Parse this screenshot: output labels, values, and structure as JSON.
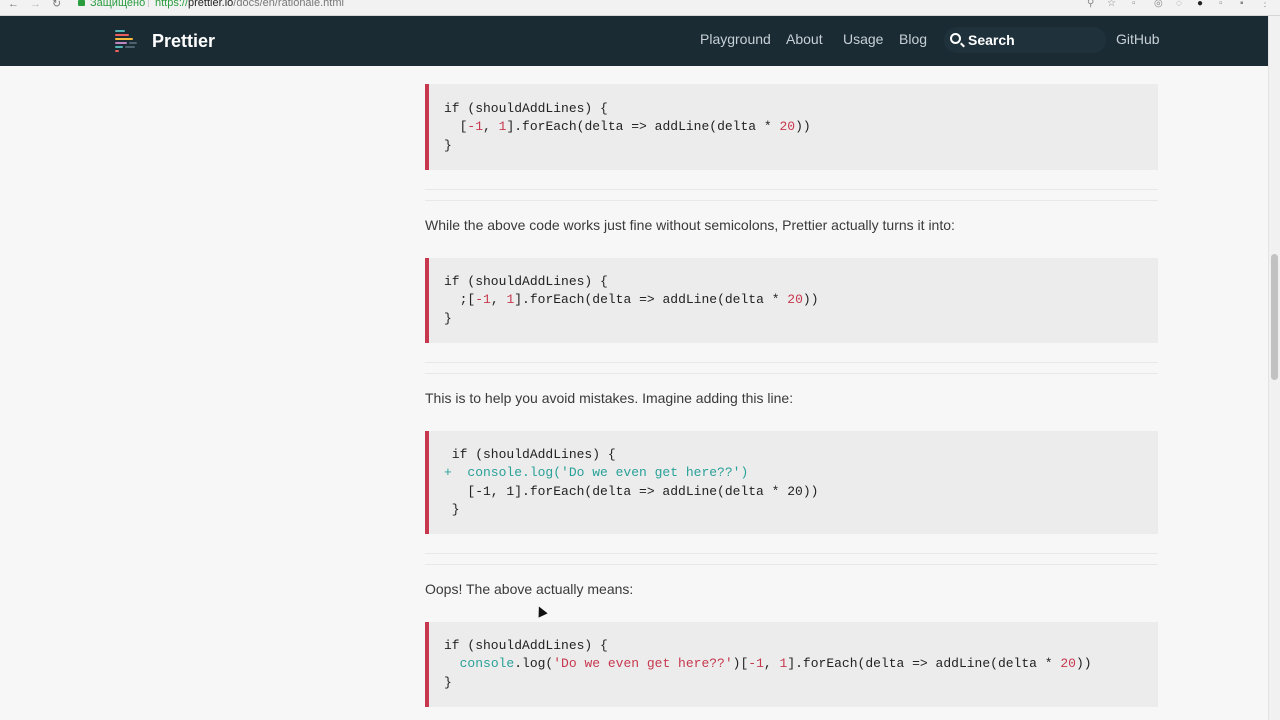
{
  "browser": {
    "secure_label": "Защищено",
    "url_proto": "https://",
    "url_host": "prettier.io",
    "url_path": "/docs/en/rationale.html"
  },
  "nav": {
    "brand": "Prettier",
    "links": [
      "Playground",
      "About",
      "Usage",
      "Blog"
    ],
    "search_placeholder": "Search",
    "github": "GitHub"
  },
  "content": {
    "para1": "While the above code works just fine without semicolons, Prettier actually turns it into:",
    "para2": "This is to help you avoid mistakes. Imagine adding this line:",
    "para3": "Oops! The above actually means:"
  },
  "code_blocks": [
    {
      "lines": [
        [
          {
            "t": "if (shouldAddLines) {"
          }
        ],
        [
          {
            "t": "  ["
          },
          {
            "t": "-1",
            "c": "num"
          },
          {
            "t": ", "
          },
          {
            "t": "1",
            "c": "num"
          },
          {
            "t": "].forEach(delta => addLine(delta * "
          },
          {
            "t": "20",
            "c": "num"
          },
          {
            "t": "))"
          }
        ],
        [
          {
            "t": "}"
          }
        ]
      ]
    },
    {
      "lines": [
        [
          {
            "t": "if (shouldAddLines) {"
          }
        ],
        [
          {
            "t": "  ;["
          },
          {
            "t": "-1",
            "c": "num"
          },
          {
            "t": ", "
          },
          {
            "t": "1",
            "c": "num"
          },
          {
            "t": "].forEach(delta => addLine(delta * "
          },
          {
            "t": "20",
            "c": "num"
          },
          {
            "t": "))"
          }
        ],
        [
          {
            "t": "}"
          }
        ]
      ]
    },
    {
      "lines": [
        [
          {
            "t": " if (shouldAddLines) {"
          }
        ],
        [
          {
            "t": "+  console.log('Do we even get here??')",
            "c": "add"
          }
        ],
        [
          {
            "t": "   [-1, 1].forEach(delta => addLine(delta * 20))"
          }
        ],
        [
          {
            "t": " }"
          }
        ]
      ]
    },
    {
      "lines": [
        [
          {
            "t": "if (shouldAddLines) {"
          }
        ],
        [
          {
            "t": "  "
          },
          {
            "t": "console",
            "c": "fn"
          },
          {
            "t": ".log("
          },
          {
            "t": "'Do we even get here??'",
            "c": "str"
          },
          {
            "t": ")["
          },
          {
            "t": "-1",
            "c": "num"
          },
          {
            "t": ", "
          },
          {
            "t": "1",
            "c": "num"
          },
          {
            "t": "].forEach(delta => addLine(delta * "
          },
          {
            "t": "20",
            "c": "num"
          },
          {
            "t": "))"
          }
        ],
        [
          {
            "t": "}"
          }
        ]
      ]
    }
  ]
}
